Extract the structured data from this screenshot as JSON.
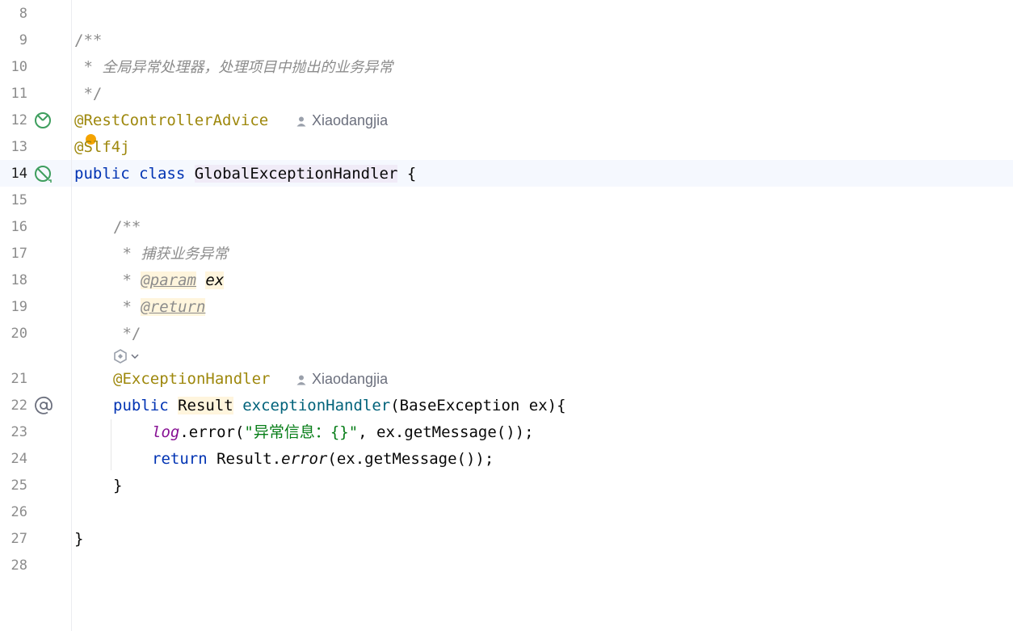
{
  "editor": {
    "current_line": "14",
    "lines": [
      {
        "num": "8"
      },
      {
        "num": "9",
        "text": "/**"
      },
      {
        "num": "10",
        "prefix": " * ",
        "text": "全局异常处理器，处理项目中抛出的业务异常"
      },
      {
        "num": "11",
        "text": " */"
      },
      {
        "num": "12",
        "text": "@RestControllerAdvice",
        "author": "Xiaodangjia"
      },
      {
        "num": "13",
        "text": "@Slf4j"
      },
      {
        "num": "14",
        "kw1": "public",
        "kw2": "class",
        "name": "GlobalExceptionHandler",
        "brace": "{"
      },
      {
        "num": "15"
      },
      {
        "num": "16",
        "text": "/**"
      },
      {
        "num": "17",
        "prefix": " * ",
        "text": "捕获业务异常"
      },
      {
        "num": "18",
        "prefix": " * ",
        "tag": "@param",
        "param": "ex"
      },
      {
        "num": "19",
        "prefix": " * ",
        "tag": "@return"
      },
      {
        "num": "20",
        "text": " */"
      },
      {
        "num": "21",
        "text": "@ExceptionHandler",
        "author": "Xiaodangjia"
      },
      {
        "num": "22",
        "kw": "public",
        "type": "Result",
        "method": "exceptionHandler",
        "params": "(BaseException ex){"
      },
      {
        "num": "23",
        "field": "log",
        "call": ".error(",
        "str": "\"异常信息：{}\"",
        "rest": ", ex.getMessage());"
      },
      {
        "num": "24",
        "kw": "return",
        "pre": "Result.",
        "stat": "error",
        "rest": "(ex.getMessage());"
      },
      {
        "num": "25",
        "text": "}"
      },
      {
        "num": "26"
      },
      {
        "num": "27",
        "text": "}"
      },
      {
        "num": "28"
      }
    ]
  },
  "icons": {
    "line12": "spring-bean-icon",
    "line14": "spring-bean-icon",
    "line22": "at-implementation-icon",
    "line13": "intention-bulb-icon",
    "inlay": "ai-assistant-icon"
  },
  "colors": {
    "keyword": "#0033b3",
    "annotation": "#9e880d",
    "comment": "#8c8c8c",
    "method": "#00627a",
    "string": "#067d17",
    "field": "#871094",
    "bean_icon": "#3e9e5e",
    "current_line_bg": "#f5f8fe"
  }
}
